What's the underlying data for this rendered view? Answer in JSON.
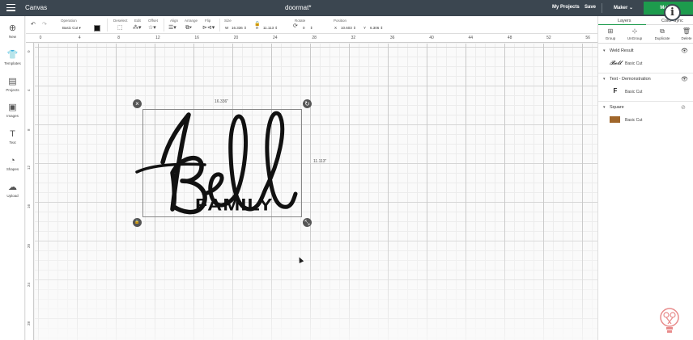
{
  "topbar": {
    "app_title": "Canvas",
    "doc_title": "doormat*",
    "my_projects": "My Projects",
    "save": "Save",
    "machine": "Maker",
    "make_button": "Make It",
    "info_icon": "i"
  },
  "toolbar": {
    "operation_label": "Operation",
    "operation_value": "Basic Cut",
    "deselect_label": "Deselect",
    "edit_label": "Edit",
    "offset_label": "Offset",
    "align_label": "Align",
    "arrange_label": "Arrange",
    "flip_label": "Flip",
    "size_label": "Size",
    "width_prefix": "W",
    "width_value": "16.336",
    "height_prefix": "H",
    "height_value": "11.113",
    "rotate_label": "Rotate",
    "rotate_value": "0",
    "position_label": "Position",
    "x_prefix": "X",
    "x_value": "10.603",
    "y_prefix": "Y",
    "y_value": "6.306",
    "swatch_color": "#111111"
  },
  "sidebar": {
    "items": [
      {
        "label": "New",
        "icon": "plus-circle-icon"
      },
      {
        "label": "Templates",
        "icon": "shirt-icon"
      },
      {
        "label": "Projects",
        "icon": "projects-icon"
      },
      {
        "label": "Images",
        "icon": "image-icon"
      },
      {
        "label": "Text",
        "icon": "text-icon"
      },
      {
        "label": "Shapes",
        "icon": "shapes-icon"
      },
      {
        "label": "Upload",
        "icon": "upload-cloud-icon"
      }
    ]
  },
  "ruler": {
    "top_labels": [
      "0",
      "4",
      "8",
      "12",
      "16",
      "20",
      "24",
      "28",
      "32",
      "36",
      "40",
      "44",
      "48",
      "52",
      "56"
    ],
    "left_labels": [
      "0",
      "4",
      "8",
      "12",
      "16",
      "20",
      "24",
      "28"
    ]
  },
  "canvas": {
    "dim_width": "16.336\"",
    "dim_height": "11.113\"",
    "script_word": "Bell",
    "family_word": "FAMILY",
    "close_glyph": "×",
    "rotate_glyph": "↻",
    "lock_glyph": "🔒",
    "resize_glyph": "⤡"
  },
  "rightpanel": {
    "tab_layers": "Layers",
    "tab_color_sync": "Color Sync",
    "actions": [
      {
        "label": "Group",
        "icon": "group-icon"
      },
      {
        "label": "UnGroup",
        "icon": "ungroup-icon"
      },
      {
        "label": "Duplicate",
        "icon": "duplicate-icon"
      },
      {
        "label": "Delete",
        "icon": "delete-icon"
      }
    ],
    "layers": [
      {
        "name": "Weld Result",
        "operation": "Basic Cut",
        "thumb": "𝓑𝓮𝓵𝓵",
        "visibility": "eye-icon"
      },
      {
        "name": "Text - Demonstration",
        "operation": "Basic Cut",
        "thumb": "F",
        "visibility": "eye-icon"
      },
      {
        "name": "Square",
        "operation": "Basic Cut",
        "thumb_color": "#a0662a",
        "visibility": "eye-hidden-icon"
      }
    ]
  }
}
